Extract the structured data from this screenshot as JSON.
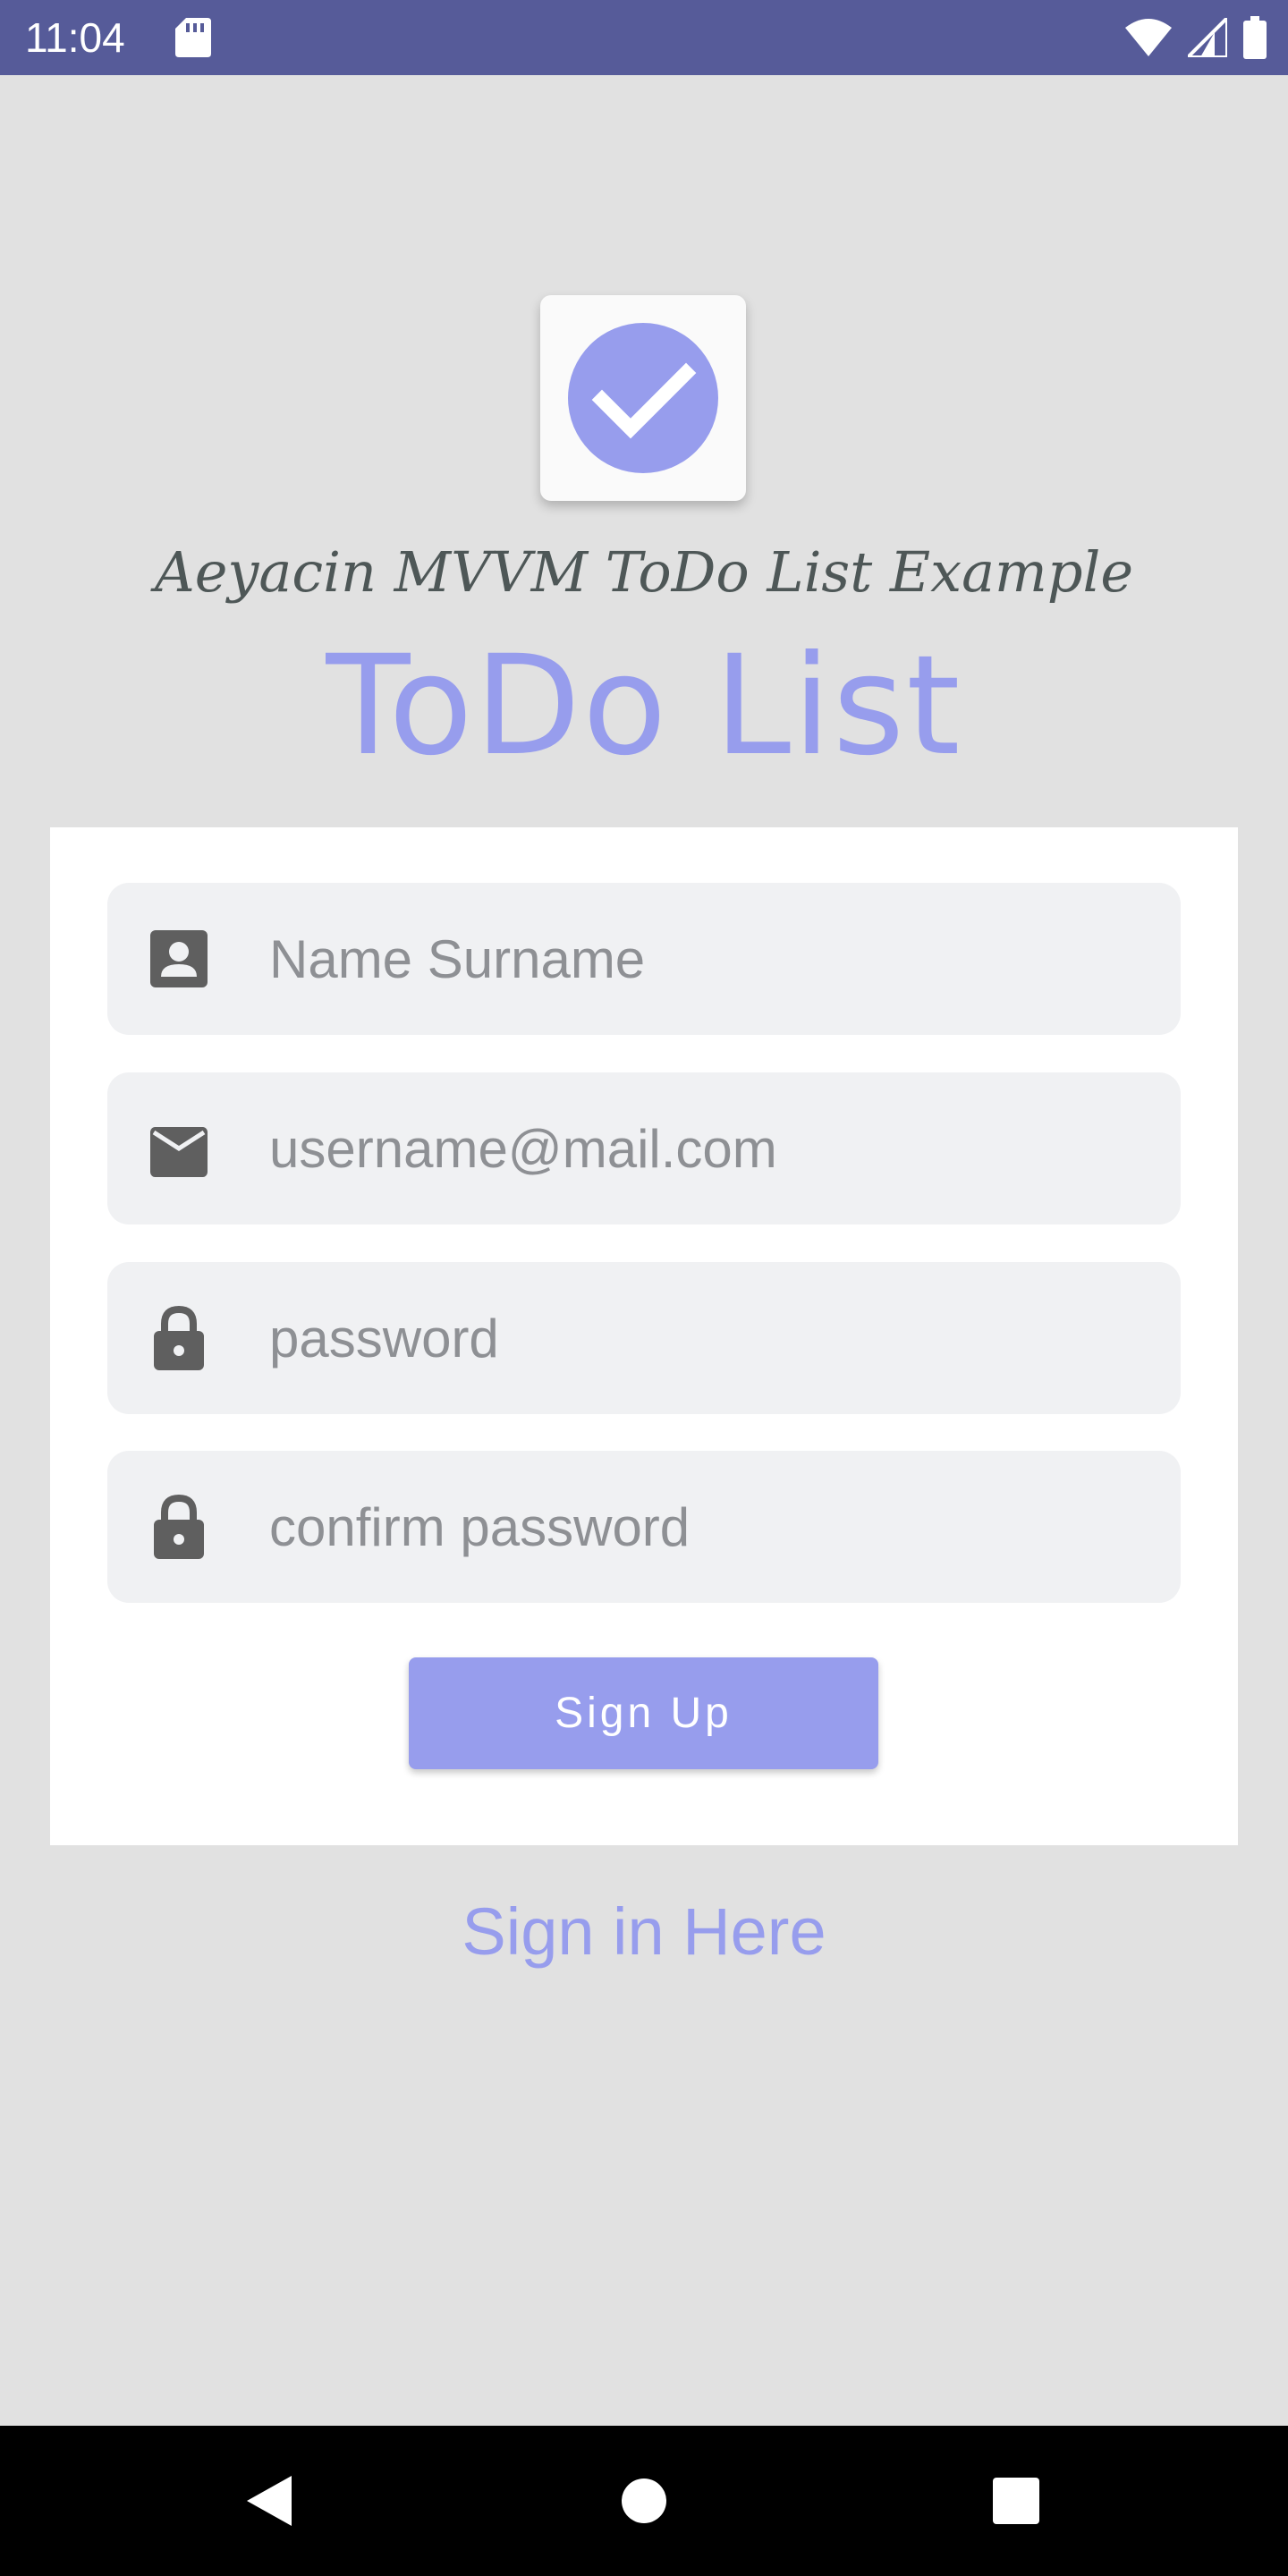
{
  "status_bar": {
    "time": "11:04"
  },
  "header": {
    "subtitle": "Aeyacin MVVM ToDo List Example",
    "title": "ToDo List"
  },
  "form": {
    "name_placeholder": "Name Surname",
    "email_placeholder": "username@mail.com",
    "password_placeholder": "password",
    "confirm_placeholder": "confirm password",
    "signup_label": "Sign Up"
  },
  "signin_link": "Sign in Here",
  "icons": {
    "logo": "check-circle-icon",
    "name": "contact-card-icon",
    "email": "envelope-icon",
    "password": "lock-icon",
    "confirm": "lock-icon",
    "status": [
      "sd-card-icon",
      "wifi-icon",
      "cellular-signal-icon",
      "battery-icon"
    ],
    "nav": [
      "back-icon",
      "home-icon",
      "recents-icon"
    ]
  },
  "colors": {
    "status_bar": "#565b99",
    "accent": "#979ded",
    "background": "#e1e1e1",
    "field": "#f0f1f3",
    "icon": "#5f5f5f"
  }
}
